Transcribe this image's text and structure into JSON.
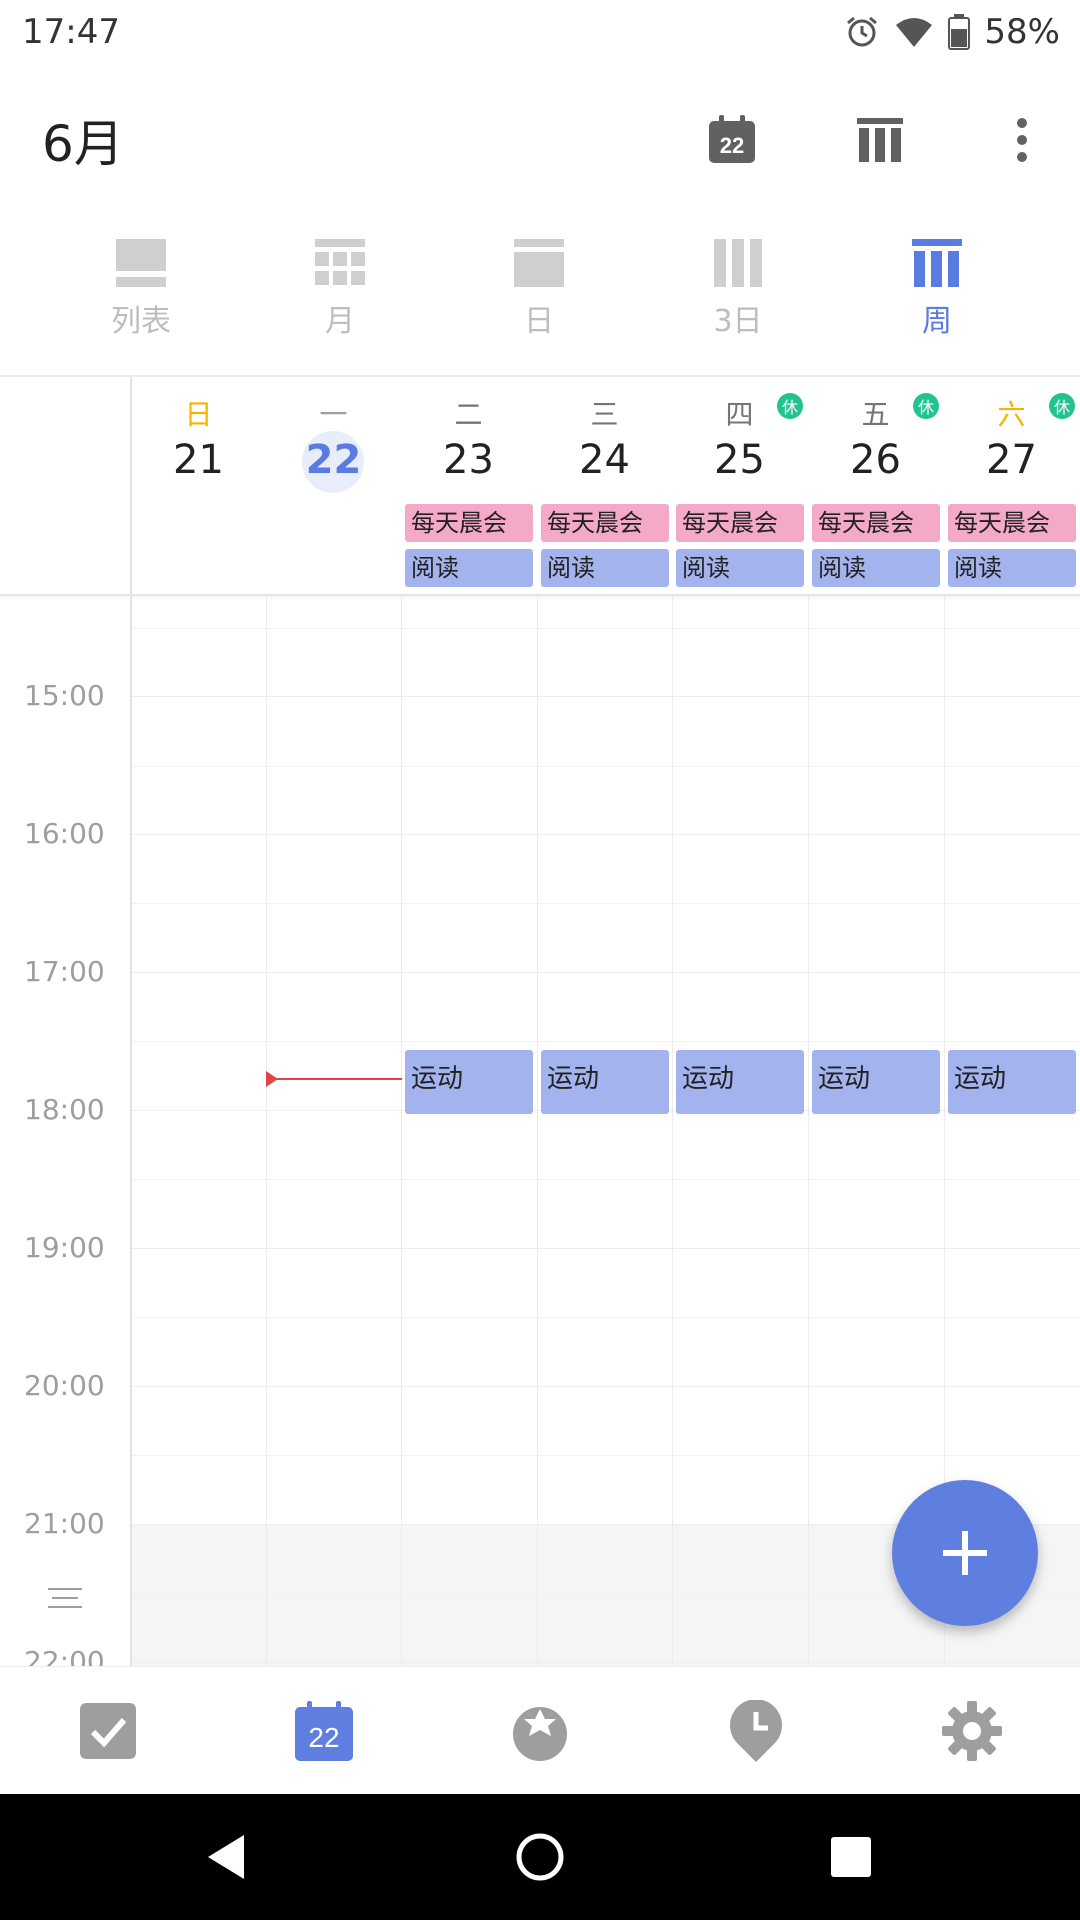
{
  "status_bar": {
    "time": "17:47",
    "battery_pct": "58%",
    "icons": [
      "alarm-icon",
      "wifi-icon",
      "battery-icon"
    ]
  },
  "header": {
    "title": "6月",
    "today_badge": "22"
  },
  "views": [
    {
      "label": "列表",
      "icon": "list-view-icon",
      "active": false
    },
    {
      "label": "月",
      "icon": "month-view-icon",
      "active": false
    },
    {
      "label": "日",
      "icon": "day-view-icon",
      "active": false
    },
    {
      "label": "3日",
      "icon": "three-day-view-icon",
      "active": false
    },
    {
      "label": "周",
      "icon": "week-view-icon",
      "active": true
    }
  ],
  "week": {
    "days": [
      {
        "dow": "日",
        "date": "21",
        "today": false,
        "holiday": "",
        "dow_color": "#f5b400"
      },
      {
        "dow": "一",
        "date": "22",
        "today": true,
        "holiday": "",
        "dow_color": "#9e9e9e"
      },
      {
        "dow": "二",
        "date": "23",
        "today": false,
        "holiday": "",
        "dow_color": "#757575"
      },
      {
        "dow": "三",
        "date": "24",
        "today": false,
        "holiday": "",
        "dow_color": "#757575"
      },
      {
        "dow": "四",
        "date": "25",
        "today": false,
        "holiday": "休",
        "dow_color": "#757575"
      },
      {
        "dow": "五",
        "date": "26",
        "today": false,
        "holiday": "休",
        "dow_color": "#757575"
      },
      {
        "dow": "六",
        "date": "27",
        "today": false,
        "holiday": "休",
        "dow_color": "#f5b400"
      }
    ],
    "allday_events": {
      "meeting": "每天晨会",
      "reading": "阅读"
    }
  },
  "grid": {
    "hours": [
      "15:00",
      "16:00",
      "17:00",
      "18:00",
      "19:00",
      "20:00",
      "21:00",
      "22:00"
    ],
    "exercise_event": "运动"
  },
  "tabs": [
    {
      "icon": "task-check-icon",
      "active": false
    },
    {
      "icon": "calendar-icon",
      "active": true,
      "badge": "22"
    },
    {
      "icon": "pomodoro-icon",
      "active": false
    },
    {
      "icon": "clock-icon",
      "active": false
    },
    {
      "icon": "settings-gear-icon",
      "active": false
    }
  ],
  "colors": {
    "accent": "#5f7fe0",
    "meeting": "#f4a9c8",
    "event": "#a3b3ee",
    "holiday": "#22c38e",
    "now": "#e04545"
  }
}
